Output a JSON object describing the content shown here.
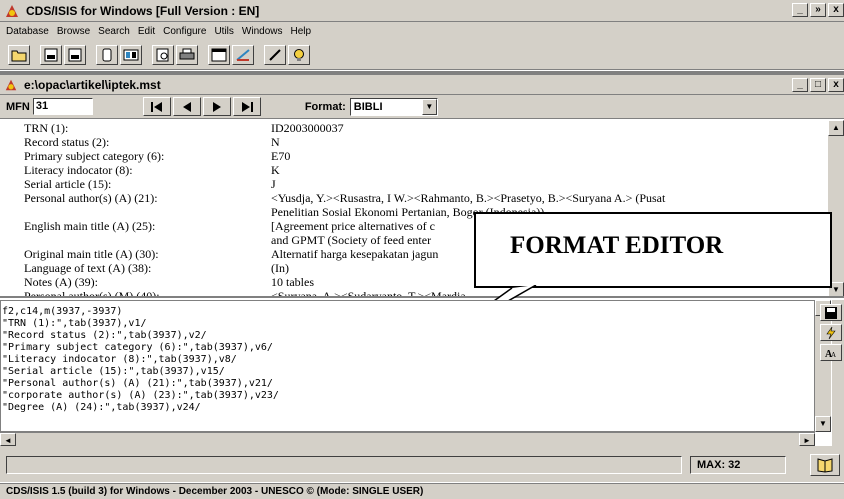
{
  "app": {
    "title": "CDS/ISIS for Windows [Full Version : EN]",
    "controls": [
      "_",
      "»",
      "x"
    ]
  },
  "menu": [
    "Database",
    "Browse",
    "Search",
    "Edit",
    "Configure",
    "Utils",
    "Windows",
    "Help"
  ],
  "toolbar": {
    "icons": [
      "open-folder-icon",
      "txt-export-icon",
      "rtf-export-icon",
      "copy-icon",
      "db-icon",
      "preview-icon",
      "print-icon",
      "window-icon",
      "pencil-ruler-icon",
      "pencil-icon",
      "lightbulb-icon"
    ]
  },
  "doc": {
    "title": "e:\\opac\\artikel\\iptek.mst",
    "controls": [
      "_",
      "□",
      "x"
    ]
  },
  "nav": {
    "mfn_label": "MFN",
    "mfn_value": "31",
    "format_label": "Format:",
    "format_value": "BIBLI"
  },
  "record": {
    "fields": [
      {
        "label": "TRN (1):",
        "value": "ID2003000037"
      },
      {
        "label": "Record status (2):",
        "value": "N"
      },
      {
        "label": "Primary subject category (6):",
        "value": "E70"
      },
      {
        "label": "Literacy indocator (8):",
        "value": "K"
      },
      {
        "label": "Serial article (15):",
        "value": "J"
      },
      {
        "label": "Personal author(s) (A) (21):",
        "value": "<Yusdja, Y.><Rusastra, I W.><Rahmanto, B.><Prasetyo, B.><Suryana A.> (Pusat",
        "value2": "Penelitian Sosial Ekonomi Pertanian, Bogor (Indonesia))"
      },
      {
        "label": "English main title (A) (25):",
        "value": "[Agreement price alternatives of c",
        "value2": "and GPMT (Society of feed enter"
      },
      {
        "label": "Original main title (A) (30):",
        "value": "Alternatif harga kesepakatan jagun"
      },
      {
        "label": "Language of text (A) (38):",
        "value": "(In)"
      },
      {
        "label": "Notes (A) (39):",
        "value": "10 tables"
      },
      {
        "label": "Personal author(s) (M) (40):",
        "value": "<Suryana, A.><Sudaryanto, T.><Mardia"
      }
    ]
  },
  "callout": {
    "text": "FORMAT EDITOR"
  },
  "editor": {
    "lines": [
      "f2,c14,m(3937,-3937)",
      "\"TRN (1):\",tab(3937),v1/",
      "\"Record status (2):\",tab(3937),v2/",
      "\"Primary subject category (6):\",tab(3937),v6/",
      "\"Literacy indocator (8):\",tab(3937),v8/",
      "\"Serial article (15):\",tab(3937),v15/",
      "\"Personal author(s) (A) (21):\",tab(3937),v21/",
      "\"corporate author(s) (A) (23):\",tab(3937),v23/",
      "\"Degree (A) (24):\",tab(3937),v24/"
    ]
  },
  "max": {
    "label": "MAX: 32"
  },
  "statusbar": {
    "text": "CDS/ISIS 1.5 (build 3) for Windows - December 2003 - UNESCO © (Mode: SINGLE USER)"
  },
  "colors": {
    "chrome": "#d4d0c8",
    "shadow": "#404040",
    "highlight": "#ffffff"
  }
}
